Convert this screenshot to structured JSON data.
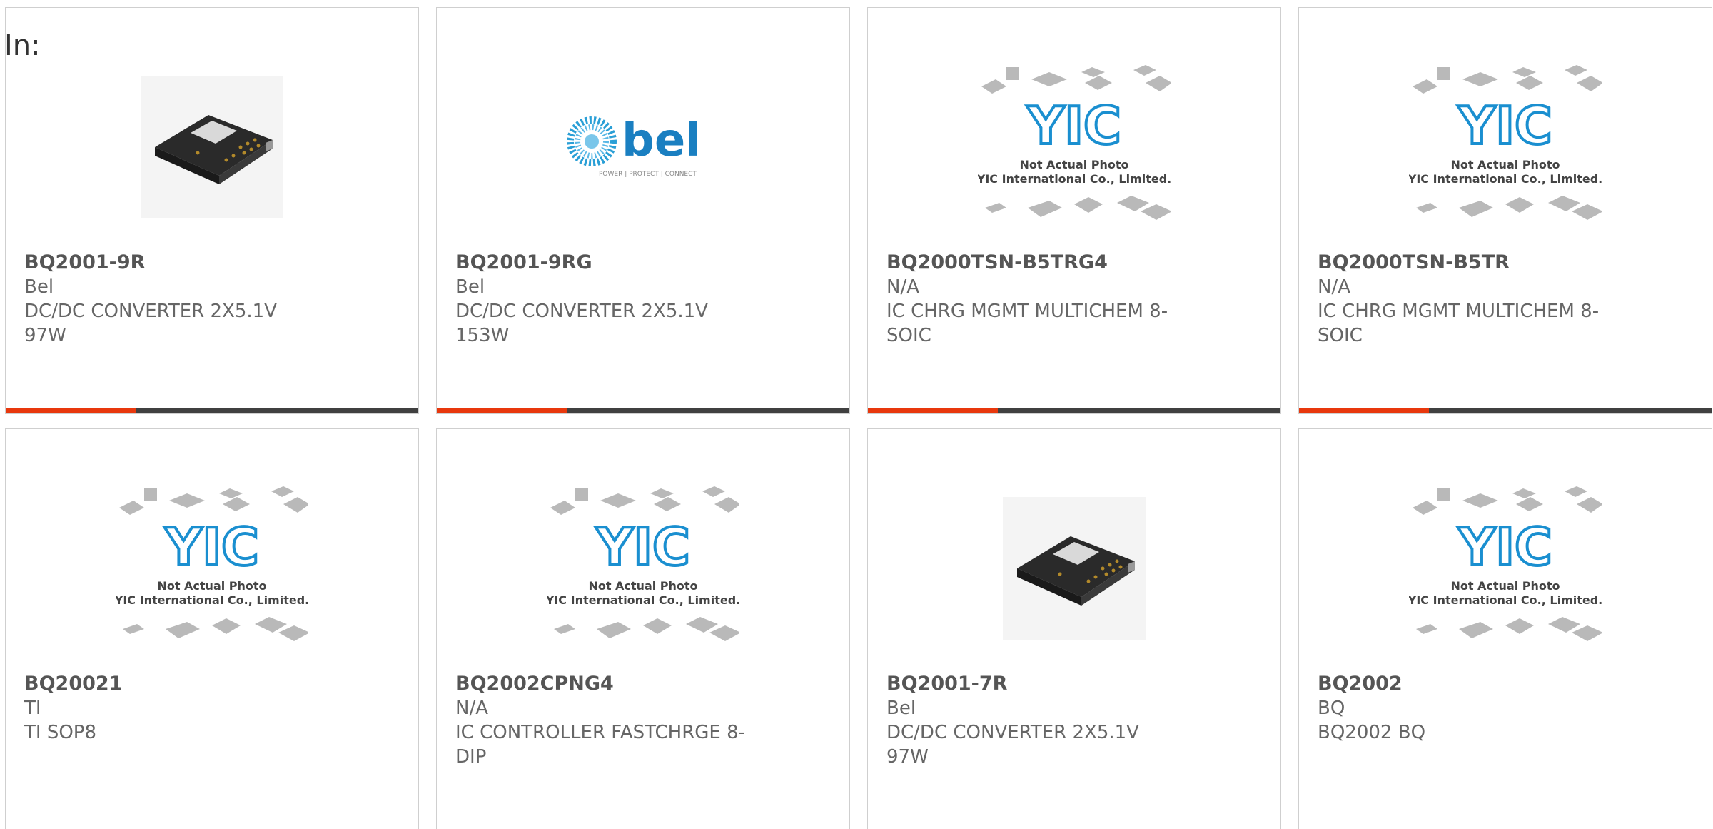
{
  "header": {
    "in_label": "In:"
  },
  "products": [
    {
      "part_number": "BQ2001-9R",
      "manufacturer": "Bel",
      "description": "DC/DC CONVERTER 2X5.1V 97W",
      "image": "converter-photo"
    },
    {
      "part_number": "BQ2001-9RG",
      "manufacturer": "Bel",
      "description": "DC/DC CONVERTER 2X5.1V 153W",
      "image": "bel-logo",
      "logo_text": "bel",
      "logo_tagline": "POWER | PROTECT | CONNECT"
    },
    {
      "part_number": "BQ2000TSN-B5TRG4",
      "manufacturer": "N/A",
      "description": "IC CHRG MGMT MULTICHEM 8-SOIC",
      "image": "placeholder"
    },
    {
      "part_number": "BQ2000TSN-B5TR",
      "manufacturer": "N/A",
      "description": "IC CHRG MGMT MULTICHEM 8-SOIC",
      "image": "placeholder"
    },
    {
      "part_number": "BQ20021",
      "manufacturer": "TI",
      "description": "TI SOP8",
      "image": "placeholder"
    },
    {
      "part_number": "BQ2002CPNG4",
      "manufacturer": "N/A",
      "description": "IC CONTROLLER FASTCHRGE 8-DIP",
      "image": "placeholder"
    },
    {
      "part_number": "BQ2001-7R",
      "manufacturer": "Bel",
      "description": "DC/DC CONVERTER 2X5.1V 97W",
      "image": "converter-photo"
    },
    {
      "part_number": "BQ2002",
      "manufacturer": "BQ",
      "description": "BQ2002 BQ",
      "image": "placeholder"
    }
  ],
  "placeholder": {
    "logo_text": "YIC",
    "line1": "Not Actual Photo",
    "line2": "YIC International Co., Limited."
  },
  "colors": {
    "accent": "#e8380d",
    "bar": "#404040",
    "border": "#cfcfcf",
    "yic_blue": "#1a8fd0",
    "bel_blue": "#1a7fc1"
  }
}
